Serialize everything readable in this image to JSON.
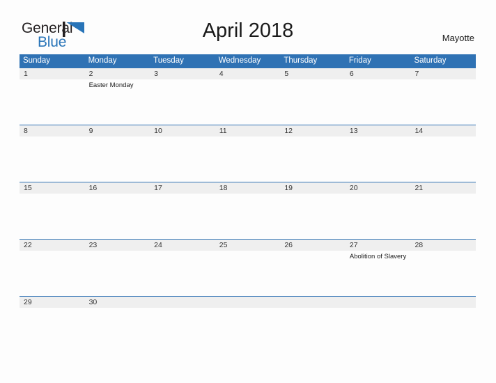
{
  "brand": {
    "name_part1": "General",
    "name_part2": "Blue",
    "mark_icon": "flag-triangle-icon",
    "primary_color": "#2874b8",
    "dark_color": "#231f20"
  },
  "header": {
    "title": "April 2018",
    "location": "Mayotte"
  },
  "theme": {
    "header_blue": "#2f72b4",
    "date_band_gray": "#efefef",
    "page_background": "#fdfdfd",
    "text_color": "#1a1a1a"
  },
  "calendar": {
    "month": "April",
    "year": "2018",
    "weekdays": [
      "Sunday",
      "Monday",
      "Tuesday",
      "Wednesday",
      "Thursday",
      "Friday",
      "Saturday"
    ],
    "weeks": [
      {
        "days": [
          {
            "date": "1",
            "event": ""
          },
          {
            "date": "2",
            "event": "Easter Monday"
          },
          {
            "date": "3",
            "event": ""
          },
          {
            "date": "4",
            "event": ""
          },
          {
            "date": "5",
            "event": ""
          },
          {
            "date": "6",
            "event": ""
          },
          {
            "date": "7",
            "event": ""
          }
        ]
      },
      {
        "days": [
          {
            "date": "8",
            "event": ""
          },
          {
            "date": "9",
            "event": ""
          },
          {
            "date": "10",
            "event": ""
          },
          {
            "date": "11",
            "event": ""
          },
          {
            "date": "12",
            "event": ""
          },
          {
            "date": "13",
            "event": ""
          },
          {
            "date": "14",
            "event": ""
          }
        ]
      },
      {
        "days": [
          {
            "date": "15",
            "event": ""
          },
          {
            "date": "16",
            "event": ""
          },
          {
            "date": "17",
            "event": ""
          },
          {
            "date": "18",
            "event": ""
          },
          {
            "date": "19",
            "event": ""
          },
          {
            "date": "20",
            "event": ""
          },
          {
            "date": "21",
            "event": ""
          }
        ]
      },
      {
        "days": [
          {
            "date": "22",
            "event": ""
          },
          {
            "date": "23",
            "event": ""
          },
          {
            "date": "24",
            "event": ""
          },
          {
            "date": "25",
            "event": ""
          },
          {
            "date": "26",
            "event": ""
          },
          {
            "date": "27",
            "event": "Abolition of Slavery"
          },
          {
            "date": "28",
            "event": ""
          }
        ]
      },
      {
        "days": [
          {
            "date": "29",
            "event": ""
          },
          {
            "date": "30",
            "event": ""
          },
          {
            "date": "",
            "event": ""
          },
          {
            "date": "",
            "event": ""
          },
          {
            "date": "",
            "event": ""
          },
          {
            "date": "",
            "event": ""
          },
          {
            "date": "",
            "event": ""
          }
        ]
      }
    ]
  }
}
